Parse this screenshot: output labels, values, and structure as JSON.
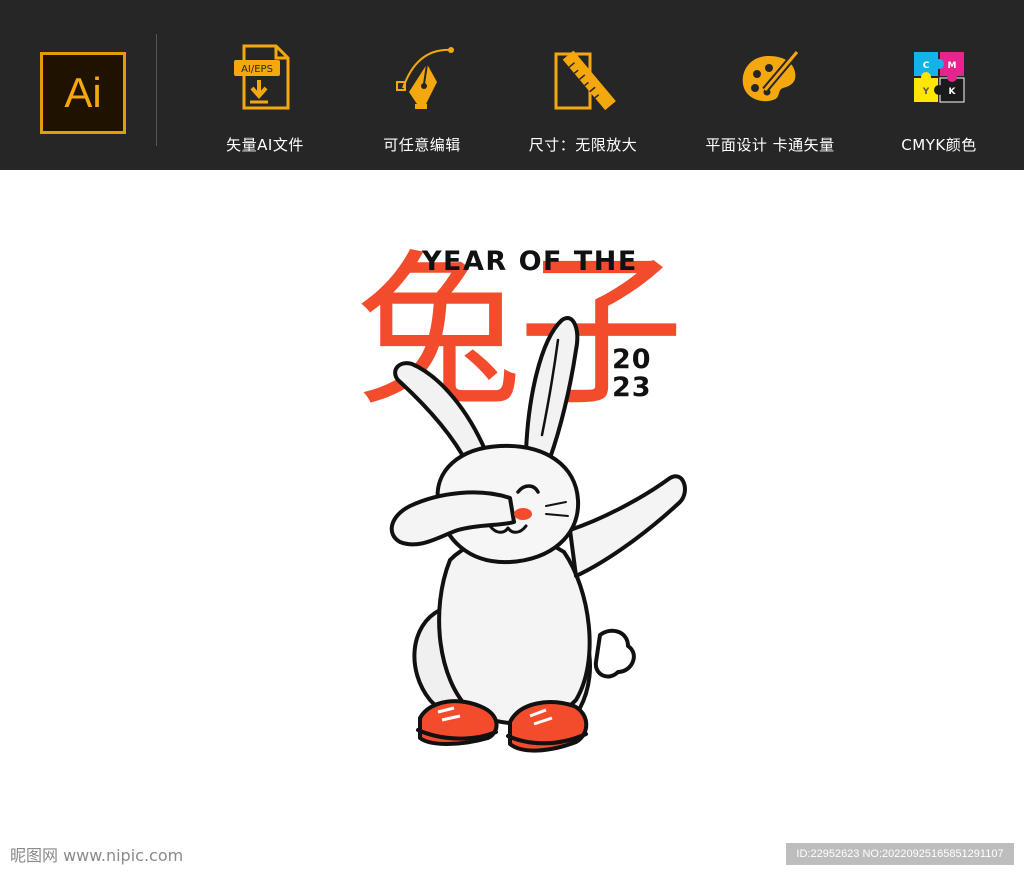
{
  "banner": {
    "logo_text": "Ai",
    "features": [
      {
        "label": "矢量AI文件",
        "icon": "file-ai-eps-icon",
        "icon_text": "AI/EPS"
      },
      {
        "label": "可任意编辑",
        "icon": "pen-tool-icon"
      },
      {
        "label": "尺寸：无限放大",
        "icon": "ruler-pencil-icon"
      },
      {
        "label": "平面设计  卡通矢量",
        "icon": "palette-icon"
      },
      {
        "label": "CMYK颜色",
        "icon": "cmyk-puzzle-icon",
        "cmyk_letters": [
          "C",
          "M",
          "Y",
          "K"
        ]
      }
    ],
    "colors": {
      "background": "#262626",
      "accent": "#f5a80d",
      "text": "#ffffff"
    }
  },
  "artwork": {
    "headline": "YEAR OF THE",
    "hanzi": "兔子",
    "year_top": "20",
    "year_bottom": "23",
    "colors": {
      "accent": "#f24c2c",
      "ink": "#111111"
    }
  },
  "watermarks": {
    "left": "昵图网 www.nipic.com",
    "right": "ID:22952623 NO:20220925165851291107"
  }
}
